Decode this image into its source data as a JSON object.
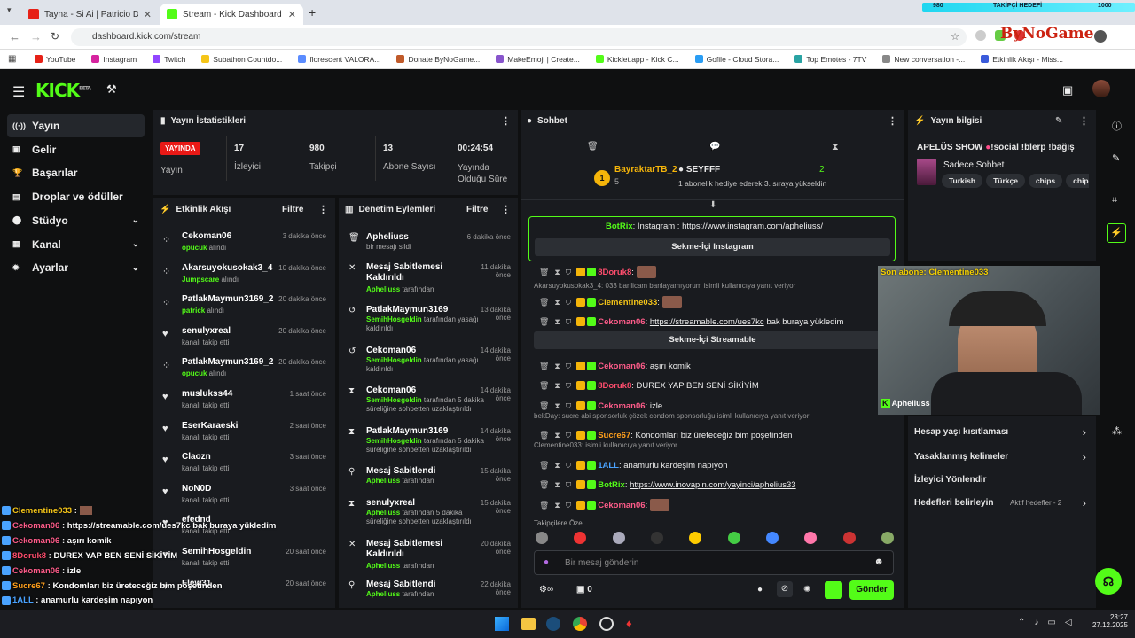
{
  "browser": {
    "tabs": [
      {
        "title": "Tayna - Si Ai | Patricio Darone R..."
      },
      {
        "title": "Stream - Kick Dashboard"
      }
    ],
    "url": "dashboard.kick.com/stream",
    "bookmarks": [
      "YouTube",
      "Instagram",
      "Twitch",
      "Subathon Countdo...",
      "florescent VALORA...",
      "Donate ByNoGame...",
      "MakeEmoji | Create...",
      "Kicklet.app - Kick C...",
      "Gofile - Cloud Stora...",
      "Top Emotes - 7TV",
      "New conversation -...",
      "Etkinlik Akışı - Miss..."
    ]
  },
  "overlay_top": {
    "count": "980",
    "label": "TAKİPÇİ HEDEFİ",
    "goal": "1000",
    "brand": "ByNoGame"
  },
  "kick": {
    "logo": "KICK",
    "beta": "BETA",
    "sidebar": [
      {
        "label": "Yayın",
        "icon": "broadcast-icon",
        "active": true
      },
      {
        "label": "Gelir",
        "icon": "wallet-icon"
      },
      {
        "label": "Başarılar",
        "icon": "trophy-icon"
      },
      {
        "label": "Droplar ve ödüller",
        "icon": "gift-icon"
      },
      {
        "label": "Stüdyo",
        "icon": "studio-icon",
        "chevron": true
      },
      {
        "label": "Kanal",
        "icon": "channel-icon",
        "chevron": true
      },
      {
        "label": "Ayarlar",
        "icon": "settings-icon",
        "chevron": true
      }
    ],
    "stats": {
      "title": "Yayın İstatistikleri",
      "live_badge": "YAYINDA",
      "live_label": "Yayın",
      "viewers": "17",
      "viewers_label": "İzleyici",
      "followers": "980",
      "followers_label": "Takipçi",
      "subs": "13",
      "subs_label": "Abone Sayısı",
      "duration": "00:24:54",
      "duration_label": "Yayında Olduğu Süre"
    },
    "activity": {
      "title": "Etkinlik Akışı",
      "filter": "Filtre",
      "items": [
        {
          "name": "Cekoman06",
          "sub": "opucuk",
          "sub2": " alındı",
          "time": "3 dakika önce"
        },
        {
          "name": "Akarsuyokusokak3_4",
          "sub": "Jumpscare",
          "sub2": " alındı",
          "time": "10 dakika önce"
        },
        {
          "name": "PatlakMaymun3169_2",
          "sub": "patrick",
          "sub2": " alındı",
          "time": "20 dakika önce"
        },
        {
          "name": "senulyxreal",
          "sub": "",
          "sub2": "kanalı takip etti",
          "time": "20 dakika önce"
        },
        {
          "name": "PatlakMaymun3169_2",
          "sub": "opucuk",
          "sub2": " alındı",
          "time": "20 dakika önce"
        },
        {
          "name": "muslukss44",
          "sub": "",
          "sub2": "kanalı takip etti",
          "time": "1 saat önce"
        },
        {
          "name": "EserKaraeski",
          "sub": "",
          "sub2": "kanalı takip etti",
          "time": "2 saat önce"
        },
        {
          "name": "Claozn",
          "sub": "",
          "sub2": "kanalı takip etti",
          "time": "3 saat önce"
        },
        {
          "name": "NoN0D",
          "sub": "",
          "sub2": "kanalı takip etti",
          "time": "3 saat önce"
        },
        {
          "name": "efednd",
          "sub": "",
          "sub2": "kanalı takip etti",
          "time": ""
        },
        {
          "name": "SemihHosgeldin",
          "sub": "",
          "sub2": "kanalı takip etti",
          "time": "20 saat önce"
        },
        {
          "name": "Flew31",
          "sub": "",
          "sub2": "",
          "time": "20 saat önce"
        }
      ]
    },
    "moderation": {
      "title": "Denetim Eylemleri",
      "filter": "Filtre",
      "items": [
        {
          "name": "Apheliuss",
          "who": "",
          "sub": "bir mesajı sildi",
          "time": "6 dakika önce"
        },
        {
          "name": "Mesaj Sabitlemesi Kaldırıldı",
          "who": "Apheliuss",
          "sub": " tarafından",
          "time": "11 dakika önce"
        },
        {
          "name": "PatlakMaymun3169",
          "who": "SemihHosgeldin",
          "sub": " tarafından yasağı kaldırıldı",
          "time": "13 dakika önce"
        },
        {
          "name": "Cekoman06",
          "who": "SemihHosgeldin",
          "sub": " tarafından yasağı kaldırıldı",
          "time": "14 dakika önce"
        },
        {
          "name": "Cekoman06",
          "who": "SemihHosgeldin",
          "sub": " tarafından 5 dakika süreliğine sohbetten uzaklaştırıldı",
          "time": "14 dakika önce"
        },
        {
          "name": "PatlakMaymun3169",
          "who": "SemihHosgeldin",
          "sub": " tarafından 5 dakika süreliğine sohbetten uzaklaştırıldı",
          "time": "14 dakika önce"
        },
        {
          "name": "Mesaj Sabitlendi",
          "who": "Apheliuss",
          "sub": " tarafından",
          "time": "15 dakika önce"
        },
        {
          "name": "senulyxreal",
          "who": "Apheliuss",
          "sub": " tarafından 5 dakika süreliğine sohbetten uzaklaştırıldı",
          "time": "15 dakika önce"
        },
        {
          "name": "Mesaj Sabitlemesi Kaldırıldı",
          "who": "Apheliuss",
          "sub": " tarafından",
          "time": "20 dakika önce"
        },
        {
          "name": "Mesaj Sabitlendi",
          "who": "Apheliuss",
          "sub": " tarafından",
          "time": "22 dakika önce"
        }
      ]
    },
    "chat": {
      "title": "Sohbet",
      "gifter": "BayraktarTB_2",
      "gifter_count": "5",
      "gifter_rank": "1",
      "recipient": "SEYFFF",
      "recipient_count": "2",
      "gift_note": "1 abonelik hediye ederek 3. sıraya yükseldin",
      "pinned_user": "BotRix",
      "pinned_text": "İnstagram :",
      "pinned_link": "https://www.instagram.com/apheliuss/",
      "inapp_instagram": "Sekme-İçi Instagram",
      "inapp_streamable": "Sekme-İçi Streamable",
      "messages": [
        {
          "user": "8Doruk8",
          "color": "#ff4d6d",
          "text": ""
        },
        {
          "reply": "Akarsuyokusokak3_4: 033 banlicam banlayamıyorum isimli kullanıcıya yanıt veriyor"
        },
        {
          "user": "Clementine033",
          "color": "#f5c518",
          "text": ""
        },
        {
          "user": "Cekoman06",
          "color": "#ff5c8a",
          "text": "https://streamable.com/ues7kc",
          "text2": " bak buraya yükledim"
        },
        {
          "user": "Cekoman06",
          "color": "#ff5c8a",
          "text": "aşırı komik"
        },
        {
          "user": "8Doruk8",
          "color": "#ff4d6d",
          "text": "DUREX YAP BEN SENİ SİKİYİM"
        },
        {
          "user": "Cekoman06",
          "color": "#ff5c8a",
          "text": "izle"
        },
        {
          "reply": "bekDay: sucre abi sponsorluk çözek condom sponsorluğu isimli kullanıcıya yanıt veriyor"
        },
        {
          "user": "Sucre67",
          "color": "#ff9f1c",
          "text": "Kondomları biz üreteceğiz bim poşetinden"
        },
        {
          "reply": "Clementine033: isimli kullanıcıya yanıt veriyor"
        },
        {
          "user": "1ALL",
          "color": "#4aa3ff",
          "text": "anamurlu kardeşim napıyon"
        },
        {
          "user": "BotRix",
          "color": "#53fc18",
          "text": "https://www.inovapin.com/yayinci/aphelius33"
        },
        {
          "user": "Cekoman06",
          "color": "#ff5c8a",
          "text": ""
        }
      ],
      "emote_label": "Takipçilere Özel",
      "input_placeholder": "Bir mesaj gönderin",
      "points": "0",
      "send": "Gönder"
    },
    "info": {
      "title": "Yayın bilgisi",
      "stream_title": "APELÜS SHOW",
      "stream_title2": "!social !blerp !bağış",
      "category": "Sadece Sohbet",
      "tags": [
        "Turkish",
        "Türkçe",
        "chips",
        "chipsmu"
      ],
      "settings": [
        {
          "label": "Hesap yaşı kısıtlaması"
        },
        {
          "label": "Yasaklanmış kelimeler"
        },
        {
          "label": "İzleyici Yönlendir"
        },
        {
          "label": "Hedefleri belirleyin",
          "extra": "Aktif hedefler - 2"
        }
      ]
    },
    "webcam": {
      "last_sub": "Son abone: Clementine033",
      "name": "Apheliuss"
    }
  },
  "overlay_chat": [
    {
      "user": "Clementine033",
      "color": "#f5c518",
      "text": ""
    },
    {
      "user": "Cekoman06",
      "color": "#ff5c8a",
      "text": "https://streamable.com/ues7kc bak buraya yükledim"
    },
    {
      "user": "Cekoman06",
      "color": "#ff5c8a",
      "text": "aşırı komik"
    },
    {
      "user": "8Doruk8",
      "color": "#ff4d6d",
      "text": "DUREX YAP BEN SENİ SİKİYİM"
    },
    {
      "user": "Cekoman06",
      "color": "#ff5c8a",
      "text": "izle"
    },
    {
      "user": "Sucre67",
      "color": "#ff9f1c",
      "text": "Kondomları biz üreteceğiz bim poşetinden"
    },
    {
      "user": "1ALL",
      "color": "#4aa3ff",
      "text": "anamurlu kardeşim napıyon"
    },
    {
      "user": "BotRix",
      "color": "#53fc18",
      "text": "https://www.inovapin.com/yayinci/aphelius33"
    },
    {
      "user": "Cekoman06",
      "color": "#ff5c8a",
      "text": ""
    }
  ],
  "taskbar": {
    "time": "23:27",
    "date": "27.12.2025"
  }
}
